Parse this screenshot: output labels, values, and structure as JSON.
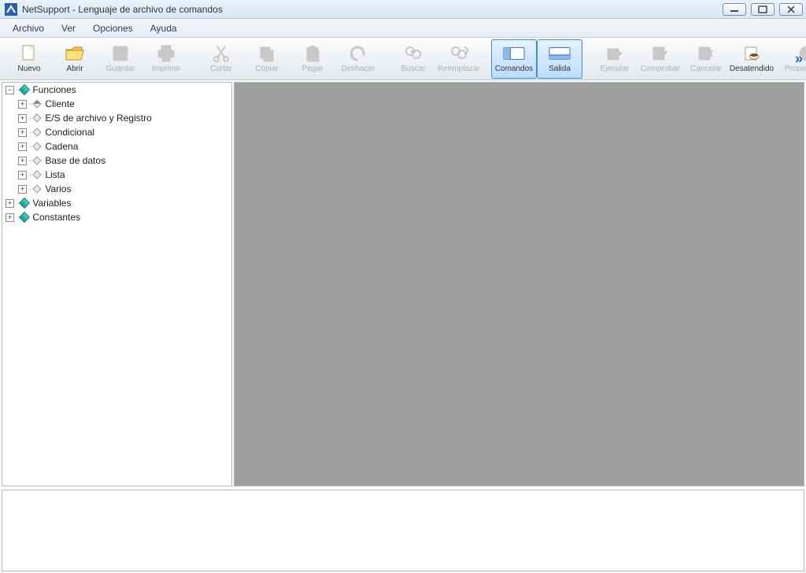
{
  "title": "NetSupport - Lenguaje de archivo de comandos",
  "menu": {
    "items": [
      "Archivo",
      "Ver",
      "Opciones",
      "Ayuda"
    ]
  },
  "toolbar": {
    "items": [
      {
        "label": "Nuevo",
        "enabled": true,
        "icon": "file-new-icon"
      },
      {
        "label": "Abrir",
        "enabled": true,
        "icon": "folder-open-icon"
      },
      {
        "label": "Guardar",
        "enabled": false,
        "icon": "save-icon"
      },
      {
        "label": "Imprimir",
        "enabled": false,
        "icon": "print-icon"
      },
      {
        "label": "Cortar",
        "enabled": false,
        "icon": "cut-icon"
      },
      {
        "label": "Copiar",
        "enabled": false,
        "icon": "copy-icon"
      },
      {
        "label": "Pegar",
        "enabled": false,
        "icon": "paste-icon"
      },
      {
        "label": "Deshacer",
        "enabled": false,
        "icon": "undo-icon"
      },
      {
        "label": "Buscar",
        "enabled": false,
        "icon": "find-icon"
      },
      {
        "label": "Reemplazar",
        "enabled": false,
        "icon": "replace-icon"
      },
      {
        "label": "Comandos",
        "enabled": true,
        "active": true,
        "icon": "commands-icon"
      },
      {
        "label": "Salida",
        "enabled": true,
        "active": true,
        "icon": "output-icon"
      },
      {
        "label": "Ejecutar",
        "enabled": false,
        "icon": "run-icon"
      },
      {
        "label": "Comprobar",
        "enabled": false,
        "icon": "check-icon"
      },
      {
        "label": "Cancelar",
        "enabled": false,
        "icon": "cancel-icon"
      },
      {
        "label": "Desatendido",
        "enabled": true,
        "icon": "unattended-icon"
      },
      {
        "label": "Propiedades",
        "enabled": false,
        "icon": "properties-icon"
      }
    ]
  },
  "tree": {
    "roots": [
      {
        "label": "Funciones",
        "expanded": true,
        "children": [
          {
            "label": "Cliente"
          },
          {
            "label": "E/S de archivo y Registro"
          },
          {
            "label": "Condicional"
          },
          {
            "label": "Cadena"
          },
          {
            "label": "Base de datos"
          },
          {
            "label": "Lista"
          },
          {
            "label": "Varios"
          }
        ]
      },
      {
        "label": "Variables",
        "expanded": false
      },
      {
        "label": "Constantes",
        "expanded": false
      }
    ]
  }
}
